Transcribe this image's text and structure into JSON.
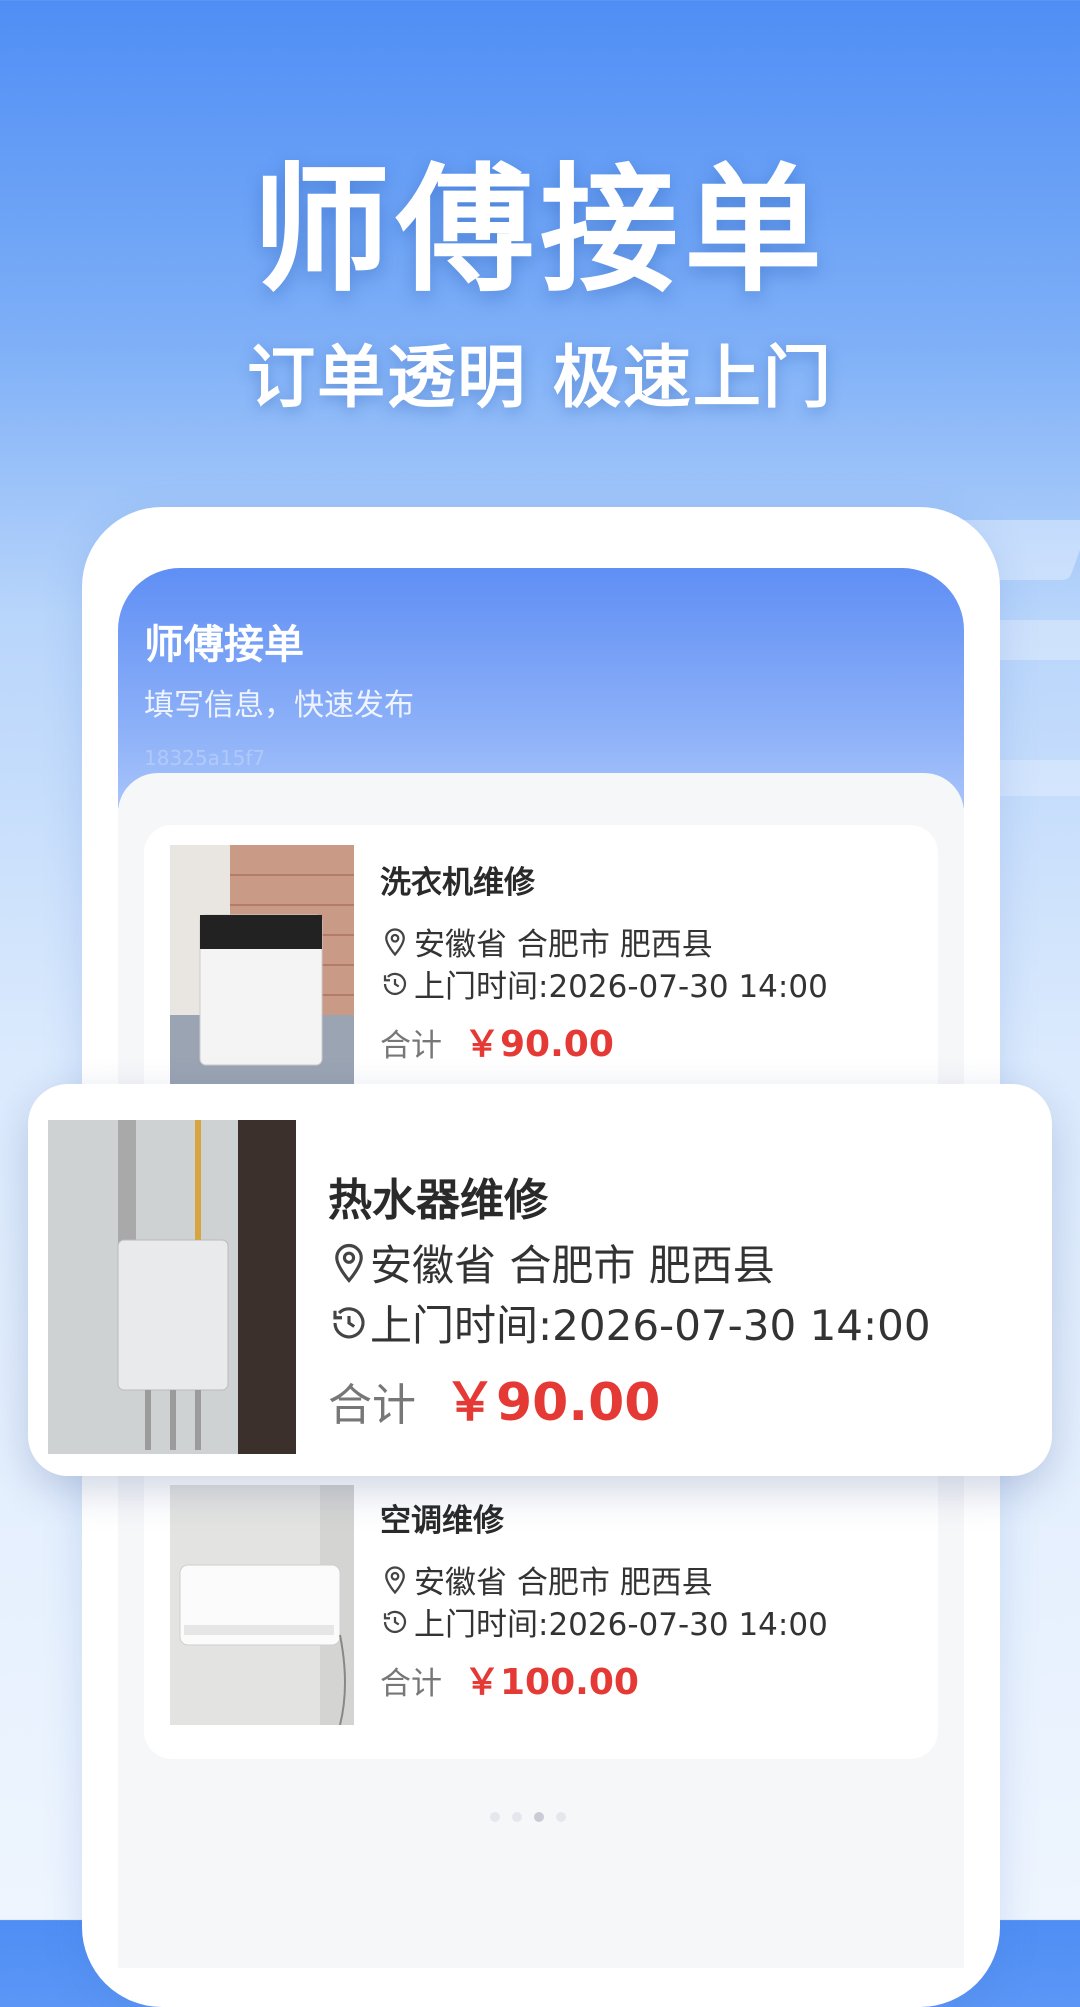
{
  "hero": {
    "title": "师傅接单",
    "subtitle": "订单透明 极速上门"
  },
  "app": {
    "title": "师傅接单",
    "subtitle": "填写信息，快速发布",
    "faint_text": "18325a15f7"
  },
  "orders": [
    {
      "title": "洗衣机维修",
      "location": "安徽省 合肥市 肥西县",
      "time": "上门时间:2026-07-30 14:00",
      "total_label": "合计",
      "price": "￥90.00",
      "image": "washing-machine-photo"
    },
    {
      "title": "热水器维修",
      "location": "安徽省 合肥市 肥西县",
      "time": "上门时间:2026-07-30 14:00",
      "total_label": "合计",
      "price": "￥90.00",
      "image": "water-heater-photo"
    },
    {
      "title": "空调维修",
      "location": "安徽省 合肥市 肥西县",
      "time": "上门时间:2026-07-30 14:00",
      "total_label": "合计",
      "price": "￥100.00",
      "image": "air-conditioner-photo"
    }
  ],
  "carousel": {
    "page_count": 4,
    "active_index": 2
  },
  "colors": {
    "accent": "#5f8ff5",
    "price": "#e53935"
  }
}
